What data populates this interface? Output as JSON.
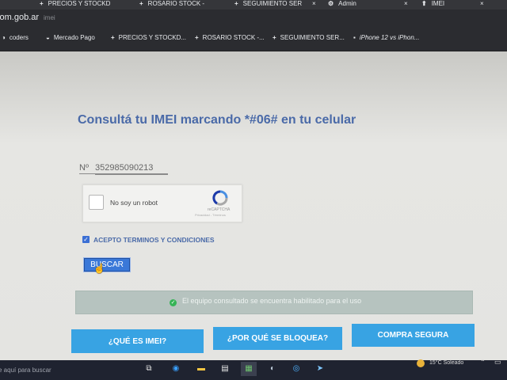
{
  "browser": {
    "tabs": [
      {
        "label": "PRECIOS Y STOCKD",
        "icon": "+"
      },
      {
        "label": "ROSARIO STOCK -",
        "icon": "+"
      },
      {
        "label": "SEGUIMIENTO SER",
        "icon": "+"
      },
      {
        "label": "Admin",
        "icon": "⚙"
      },
      {
        "label": "IMEI",
        "icon": "⬆"
      }
    ],
    "close_glyph": "×",
    "url": "com.gob.ar",
    "url_suffix": "imei",
    "bookmarks": [
      {
        "label": "coders",
        "icon": "◑"
      },
      {
        "label": "Mercado Pago",
        "icon": "◒"
      },
      {
        "label": "PRECIOS Y STOCKD...",
        "icon": "+"
      },
      {
        "label": "ROSARIO STOCK -...",
        "icon": "+"
      },
      {
        "label": "SEGUIMIENTO SER...",
        "icon": "+"
      },
      {
        "label": "iPhone 12 vs iPhon...",
        "icon": "▪"
      }
    ]
  },
  "page": {
    "title": "Consultá tu IMEI marcando *#06# en tu celular",
    "imei_field": {
      "prefix": "Nº",
      "value": "352985090213"
    },
    "captcha": {
      "label": "No soy un robot",
      "brand": "reCAPTCHA",
      "links": "Privacidad - Términos"
    },
    "terms": {
      "checked": true,
      "label": "ACEPTO TERMINOS Y CONDICIONES"
    },
    "search_button": "BUSCAR",
    "result": {
      "status": "success",
      "text": "El equipo consultado se encuentra habilitado para el uso"
    },
    "cta_buttons": [
      "¿QUÉ ES IMEI?",
      "¿POR QUÉ SE BLOQUEA?",
      "COMPRA SEGURA"
    ],
    "colors": {
      "title": "#4a6aa8",
      "cta": "#38a3e3",
      "button": "#3a78d8",
      "success": "#35b456"
    }
  },
  "taskbar": {
    "search_placeholder": "se aquí para buscar",
    "icons": [
      "task-view-icon",
      "edge-icon",
      "file-explorer-icon",
      "notepad-icon",
      "store-icon",
      "app-icon",
      "chrome-icon",
      "telegram-icon"
    ],
    "weather": {
      "temp": "15°C",
      "condition": "Soleado"
    }
  }
}
